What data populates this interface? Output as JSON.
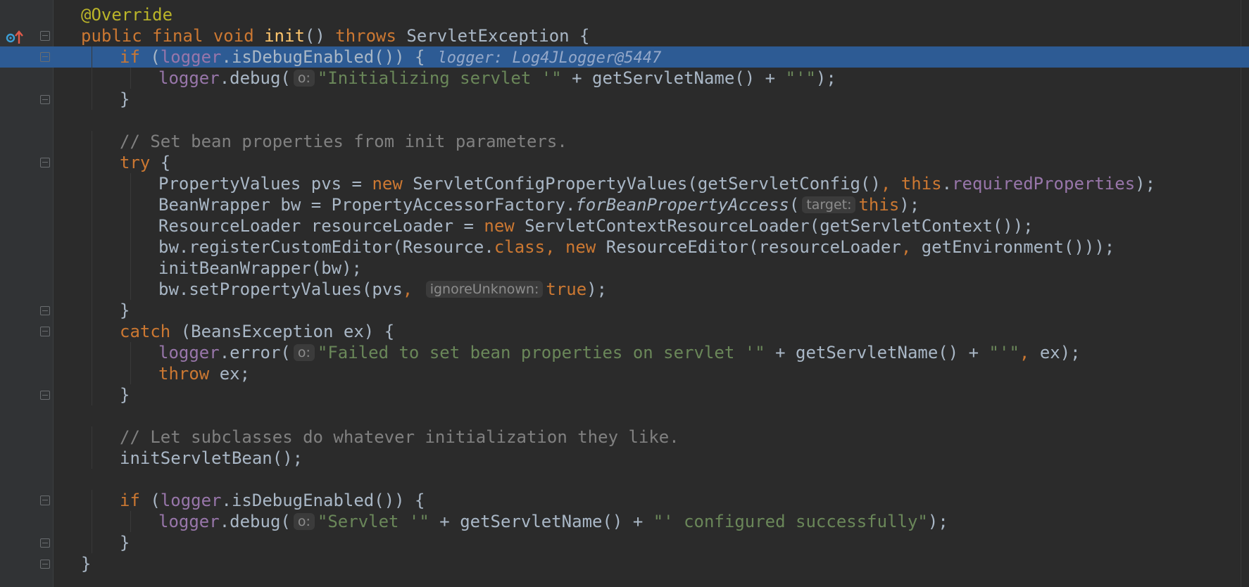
{
  "editor": {
    "language": "Java",
    "lines": [
      {
        "n": 1,
        "indent": 0,
        "tokens": [
          [
            "ann",
            "@Override"
          ]
        ]
      },
      {
        "n": 2,
        "indent": 0,
        "tokens": [
          [
            "kw",
            "public final void "
          ],
          [
            "fn",
            "init"
          ],
          [
            "p",
            "() "
          ],
          [
            "kw",
            "throws "
          ],
          [
            "p",
            "ServletException {"
          ]
        ]
      },
      {
        "n": 3,
        "indent": 1,
        "tokens": [
          [
            "kw",
            "if "
          ],
          [
            "p",
            "("
          ],
          [
            "fld",
            "logger"
          ],
          [
            "p",
            ".isDebugEnabled()) {"
          ],
          [
            "inline",
            "logger: Log4JLogger@5447"
          ]
        ]
      },
      {
        "n": 4,
        "indent": 2,
        "tokens": [
          [
            "fld",
            "logger"
          ],
          [
            "p",
            ".debug("
          ],
          [
            "hint",
            "o:"
          ],
          [
            "str",
            "\"Initializing servlet '\""
          ],
          [
            "p",
            " + getServletName() + "
          ],
          [
            "str",
            "\"'\""
          ],
          [
            "p",
            ");"
          ]
        ]
      },
      {
        "n": 5,
        "indent": 1,
        "tokens": [
          [
            "p",
            "}"
          ]
        ]
      },
      {
        "n": 6,
        "indent": 0,
        "tokens": []
      },
      {
        "n": 7,
        "indent": 1,
        "tokens": [
          [
            "cmt",
            "// Set bean properties from init parameters."
          ]
        ]
      },
      {
        "n": 8,
        "indent": 1,
        "tokens": [
          [
            "kw",
            "try "
          ],
          [
            "p",
            "{"
          ]
        ]
      },
      {
        "n": 9,
        "indent": 2,
        "tokens": [
          [
            "p",
            "PropertyValues pvs = "
          ],
          [
            "kw",
            "new "
          ],
          [
            "p",
            "ServletConfigPropertyValues(getServletConfig()"
          ],
          [
            "kw",
            ", this"
          ],
          [
            "p",
            "."
          ],
          [
            "fld",
            "requiredProperties"
          ],
          [
            "p",
            ");"
          ]
        ]
      },
      {
        "n": 10,
        "indent": 2,
        "tokens": [
          [
            "p",
            "BeanWrapper bw = PropertyAccessorFactory."
          ],
          [
            "it",
            "forBeanPropertyAccess"
          ],
          [
            "p",
            "("
          ],
          [
            "hint",
            "target:"
          ],
          [
            "kw",
            "this"
          ],
          [
            "p",
            ");"
          ]
        ]
      },
      {
        "n": 11,
        "indent": 2,
        "tokens": [
          [
            "p",
            "ResourceLoader resourceLoader = "
          ],
          [
            "kw",
            "new "
          ],
          [
            "p",
            "ServletContextResourceLoader(getServletContext());"
          ]
        ]
      },
      {
        "n": 12,
        "indent": 2,
        "tokens": [
          [
            "p",
            "bw.registerCustomEditor(Resource."
          ],
          [
            "kw",
            "class, new "
          ],
          [
            "p",
            "ResourceEditor(resourceLoader"
          ],
          [
            "kw",
            ", "
          ],
          [
            "p",
            "getEnvironment()));"
          ]
        ]
      },
      {
        "n": 13,
        "indent": 2,
        "tokens": [
          [
            "p",
            "initBeanWrapper(bw);"
          ]
        ]
      },
      {
        "n": 14,
        "indent": 2,
        "tokens": [
          [
            "p",
            "bw.setPropertyValues(pvs"
          ],
          [
            "kw",
            ", "
          ],
          [
            "hint",
            "ignoreUnknown:"
          ],
          [
            "kw",
            "true"
          ],
          [
            "p",
            ");"
          ]
        ]
      },
      {
        "n": 15,
        "indent": 1,
        "tokens": [
          [
            "p",
            "}"
          ]
        ]
      },
      {
        "n": 16,
        "indent": 1,
        "tokens": [
          [
            "kw",
            "catch "
          ],
          [
            "p",
            "(BeansException ex) {"
          ]
        ]
      },
      {
        "n": 17,
        "indent": 2,
        "tokens": [
          [
            "fld",
            "logger"
          ],
          [
            "p",
            ".error("
          ],
          [
            "hint",
            "o:"
          ],
          [
            "str",
            "\"Failed to set bean properties on servlet '\""
          ],
          [
            "p",
            " + getServletName() + "
          ],
          [
            "str",
            "\"'\""
          ],
          [
            "kw",
            ", "
          ],
          [
            "p",
            "ex);"
          ]
        ]
      },
      {
        "n": 18,
        "indent": 2,
        "tokens": [
          [
            "kw",
            "throw "
          ],
          [
            "p",
            "ex;"
          ]
        ]
      },
      {
        "n": 19,
        "indent": 1,
        "tokens": [
          [
            "p",
            "}"
          ]
        ]
      },
      {
        "n": 20,
        "indent": 0,
        "tokens": []
      },
      {
        "n": 21,
        "indent": 1,
        "tokens": [
          [
            "cmt",
            "// Let subclasses do whatever initialization they like."
          ]
        ]
      },
      {
        "n": 22,
        "indent": 1,
        "tokens": [
          [
            "p",
            "initServletBean();"
          ]
        ]
      },
      {
        "n": 23,
        "indent": 0,
        "tokens": []
      },
      {
        "n": 24,
        "indent": 1,
        "tokens": [
          [
            "kw",
            "if "
          ],
          [
            "p",
            "("
          ],
          [
            "fld",
            "logger"
          ],
          [
            "p",
            ".isDebugEnabled()) {"
          ]
        ]
      },
      {
        "n": 25,
        "indent": 2,
        "tokens": [
          [
            "fld",
            "logger"
          ],
          [
            "p",
            ".debug("
          ],
          [
            "hint",
            "o:"
          ],
          [
            "str",
            "\"Servlet '\""
          ],
          [
            "p",
            " + getServletName() + "
          ],
          [
            "str",
            "\"' configured successfully\""
          ],
          [
            "p",
            ");"
          ]
        ]
      },
      {
        "n": 26,
        "indent": 1,
        "tokens": [
          [
            "p",
            "}"
          ]
        ]
      },
      {
        "n": 27,
        "indent": 0,
        "tokens": [
          [
            "p",
            "}"
          ]
        ]
      }
    ],
    "execution_line": 3,
    "breakpoint_line": 3,
    "override_marker_line": 2,
    "fold_start_lines": [
      2,
      3,
      8,
      16,
      24
    ],
    "fold_end_lines": [
      5,
      15,
      19,
      26,
      27
    ],
    "colors": {
      "background": "#2b2b2b",
      "gutter": "#313335",
      "execution_highlight": "#2d5b94",
      "keyword": "#cc7832",
      "annotation": "#bbb529",
      "method_decl": "#ffc66d",
      "field": "#9876aa",
      "string": "#6a8759",
      "comment": "#808080",
      "plain": "#a9b7c6",
      "breakpoint": "#c75450"
    },
    "icons": {
      "override": "override-up-arrow-icon",
      "breakpoint": "breakpoint-checked-icon",
      "fold": "fold-toggle-icon"
    }
  }
}
